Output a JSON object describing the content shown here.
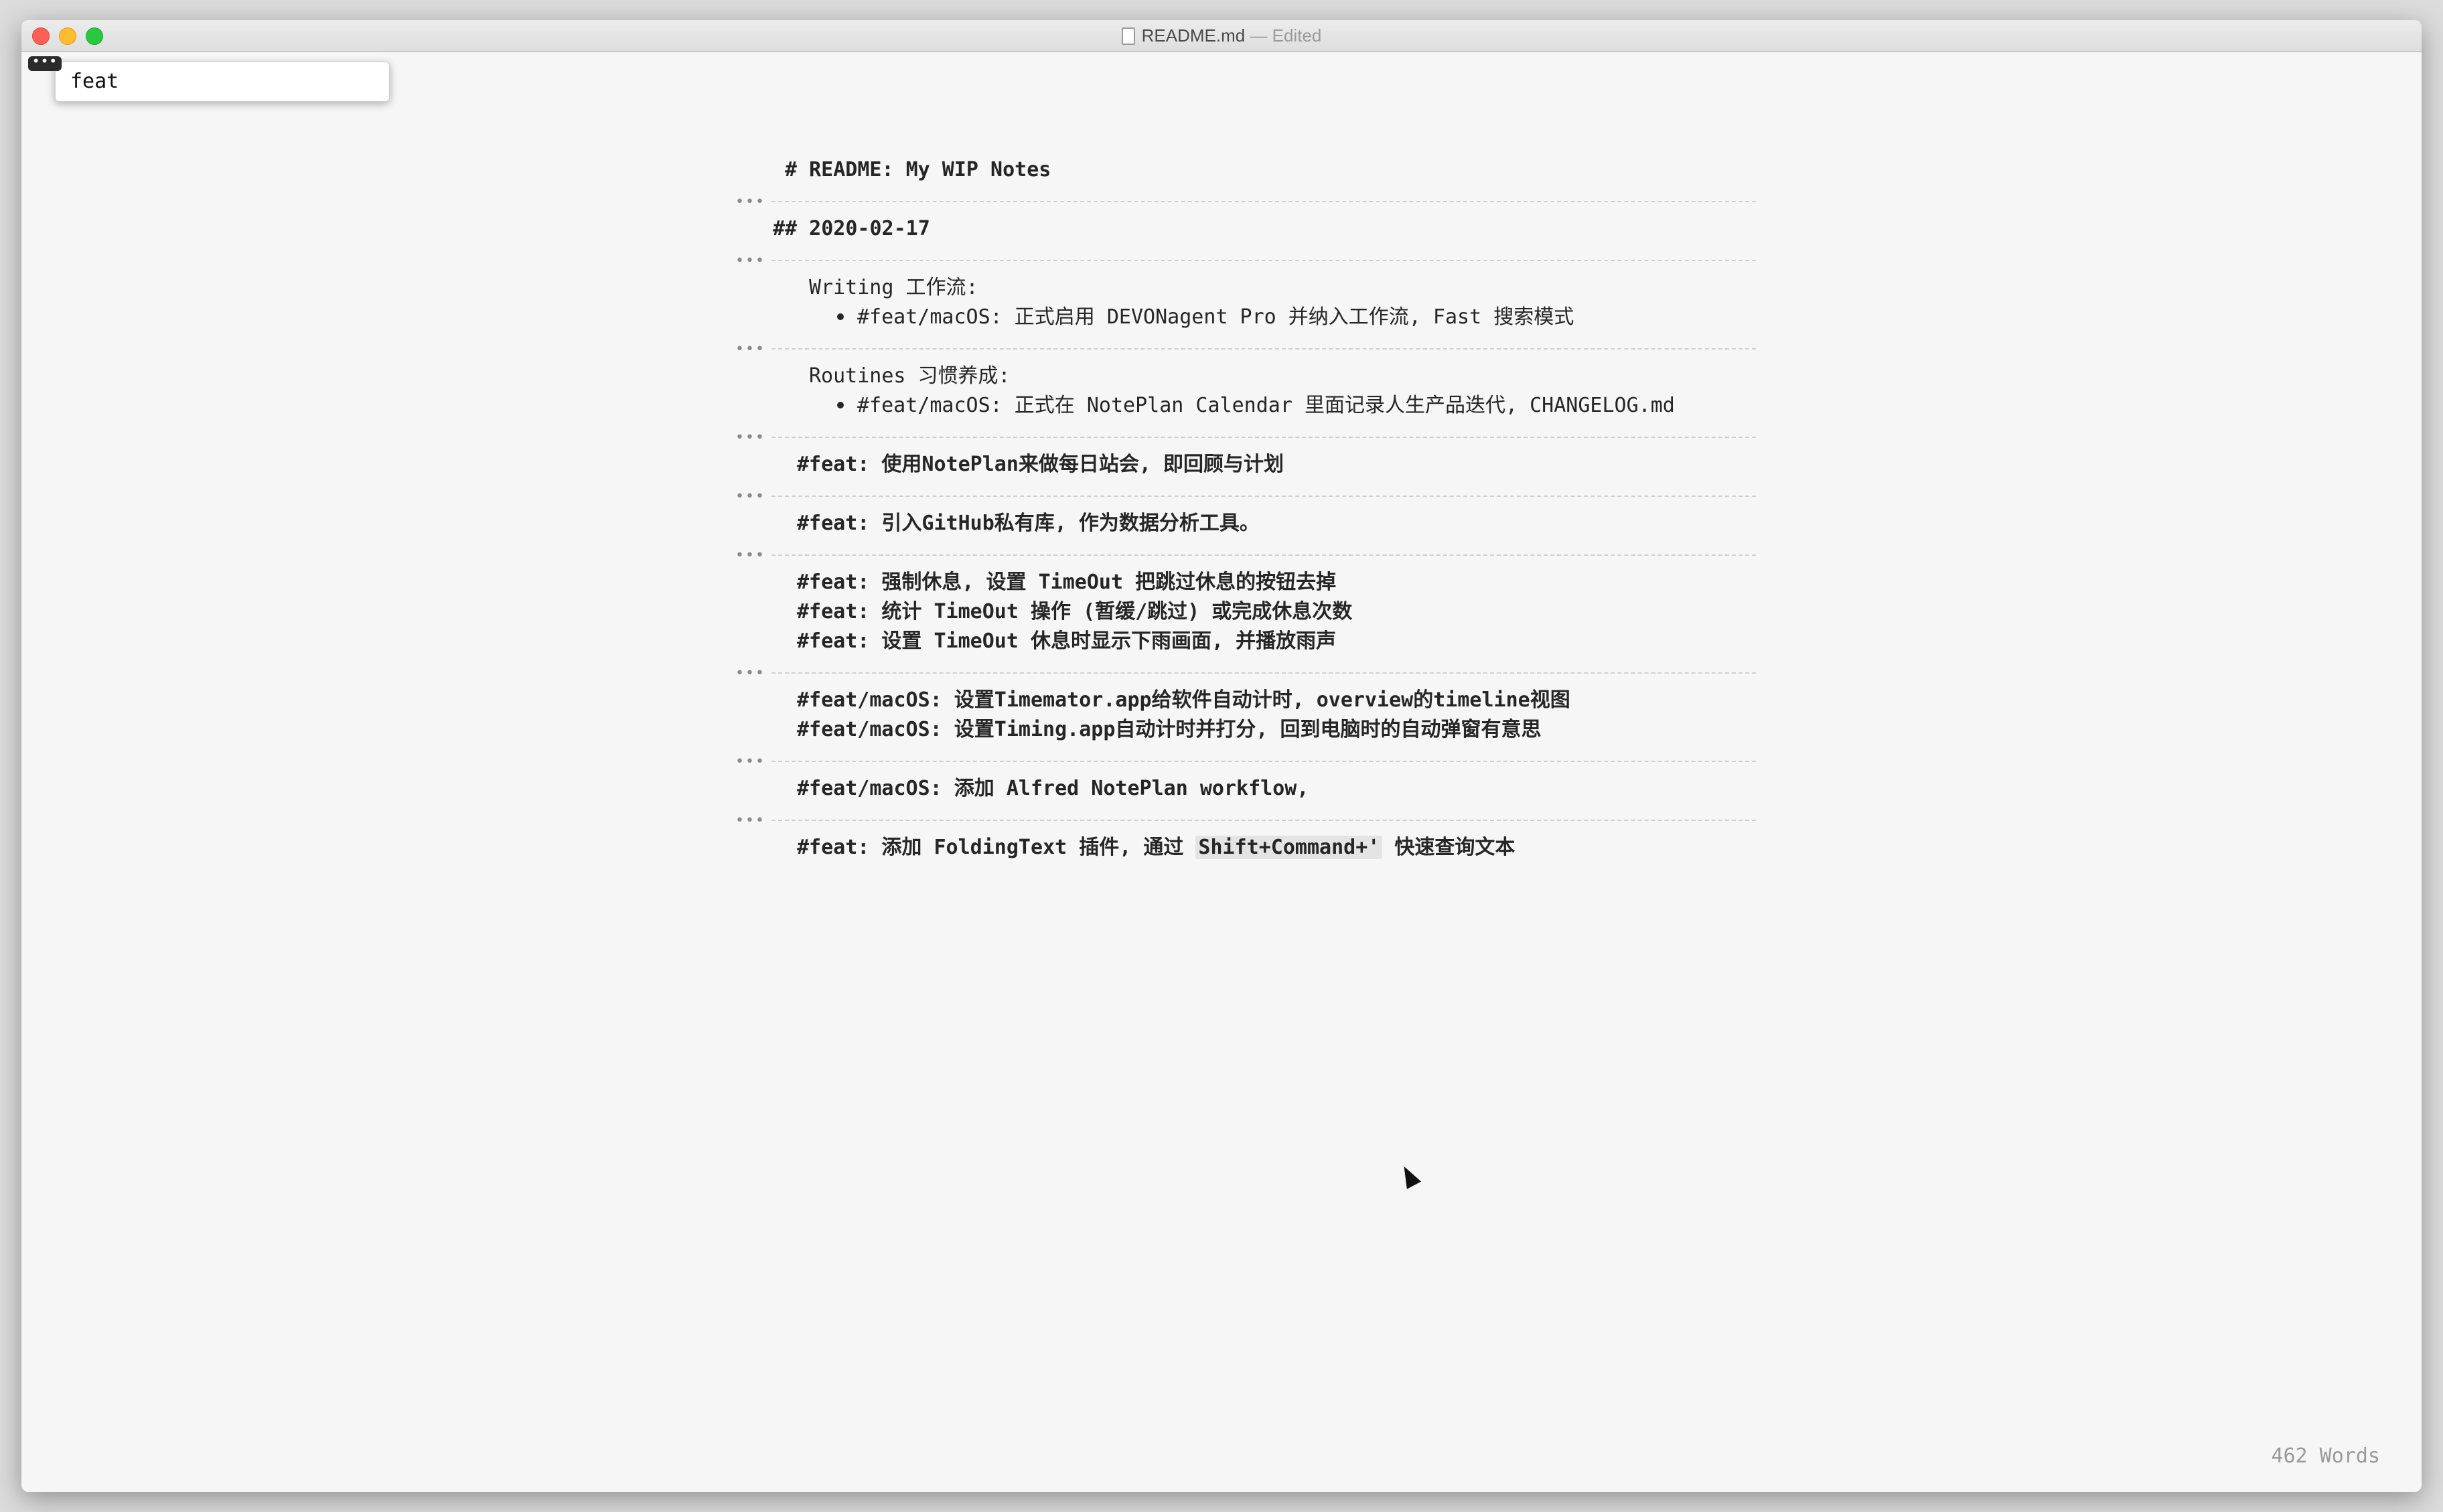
{
  "window": {
    "filename": "README.md",
    "status": "— Edited"
  },
  "search": {
    "badge": "•••",
    "value": "feat"
  },
  "document": {
    "h1": "# README: My WIP Notes",
    "h2": "## 2020-02-17",
    "fold_marker": "•••",
    "writing_label": "Writing 工作流:",
    "writing_item": "#feat/macOS: 正式启用 DEVONagent Pro 并纳入工作流, Fast 搜索模式",
    "routines_label": "Routines 习惯养成:",
    "routines_item": "#feat/macOS: 正式在 NotePlan Calendar 里面记录人生产品迭代, CHANGELOG.md",
    "l1": "#feat: 使用NotePlan来做每日站会, 即回顾与计划",
    "l2": "#feat: 引入GitHub私有库, 作为数据分析工具。",
    "l3": "#feat: 强制休息, 设置 TimeOut 把跳过休息的按钮去掉",
    "l4": "#feat: 统计 TimeOut 操作 (暂缓/跳过) 或完成休息次数",
    "l5": "#feat: 设置 TimeOut 休息时显示下雨画面, 并播放雨声",
    "l6": "#feat/macOS: 设置Timemator.app给软件自动计时, overview的timeline视图",
    "l7": "#feat/macOS: 设置Timing.app自动计时并打分, 回到电脑时的自动弹窗有意思",
    "l8": "#feat/macOS: 添加 Alfred NotePlan workflow,",
    "l9_prefix": "#feat: 添加 FoldingText 插件, 通过 ",
    "l9_code": "Shift+Command+'",
    "l9_suffix": " 快速查询文本"
  },
  "footer": {
    "word_count": "462 Words"
  }
}
